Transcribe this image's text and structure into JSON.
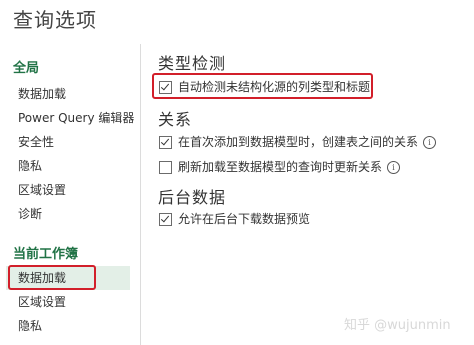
{
  "dialog": {
    "title": "查询选项"
  },
  "sidebar": {
    "global_header": "全局",
    "global_items": [
      {
        "label": "数据加载"
      },
      {
        "label": "Power Query 编辑器"
      },
      {
        "label": "安全性"
      },
      {
        "label": "隐私"
      },
      {
        "label": "区域设置"
      },
      {
        "label": "诊断"
      }
    ],
    "workbook_header": "当前工作簿",
    "workbook_items": [
      {
        "label": "数据加载",
        "selected": true
      },
      {
        "label": "区域设置"
      },
      {
        "label": "隐私"
      }
    ]
  },
  "main": {
    "type_detection": {
      "title": "类型检测",
      "option": {
        "label": "自动检测未结构化源的列类型和标题",
        "checked": true
      }
    },
    "relationships": {
      "title": "关系",
      "options": [
        {
          "label": "在首次添加到数据模型时，创建表之间的关系",
          "checked": true,
          "info": "i"
        },
        {
          "label": "刷新加载至数据模型的查询时更新关系",
          "checked": false,
          "info": "i"
        }
      ]
    },
    "background_data": {
      "title": "后台数据",
      "option": {
        "label": "允许在后台下载数据预览",
        "checked": true
      }
    }
  },
  "watermark": "知乎 @wujunmin",
  "colors": {
    "accent": "#217346",
    "highlight": "#d21f2a",
    "selected_bg": "#e3efe7"
  }
}
